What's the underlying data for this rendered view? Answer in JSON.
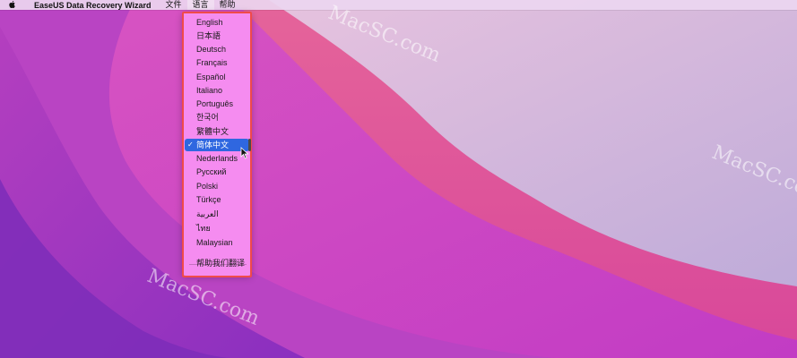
{
  "menubar": {
    "apple_icon": "apple-logo-icon",
    "app_name": "EaseUS Data Recovery Wizard",
    "items": [
      "文件",
      "语言",
      "帮助"
    ],
    "active_item": "语言"
  },
  "language_menu": {
    "items": [
      {
        "label": "English"
      },
      {
        "label": "日本語"
      },
      {
        "label": "Deutsch"
      },
      {
        "label": "Français"
      },
      {
        "label": "Español"
      },
      {
        "label": "Italiano"
      },
      {
        "label": "Português"
      },
      {
        "label": "한국어"
      },
      {
        "label": "繁體中文"
      },
      {
        "label": "简体中文",
        "selected": true,
        "check": "✓"
      },
      {
        "label": "Nederlands"
      },
      {
        "label": "Русский"
      },
      {
        "label": "Polski"
      },
      {
        "label": "Türkçe"
      },
      {
        "label": "العربية"
      },
      {
        "label": "ไทย"
      },
      {
        "label": "Malaysian"
      }
    ],
    "help_translate": "帮助我们翻译",
    "highlight_color": "#f04a4a",
    "selected_color": "#2f67e0"
  },
  "watermarks": [
    "MacSC.com",
    "MacSC.com",
    "MacSC.com"
  ]
}
